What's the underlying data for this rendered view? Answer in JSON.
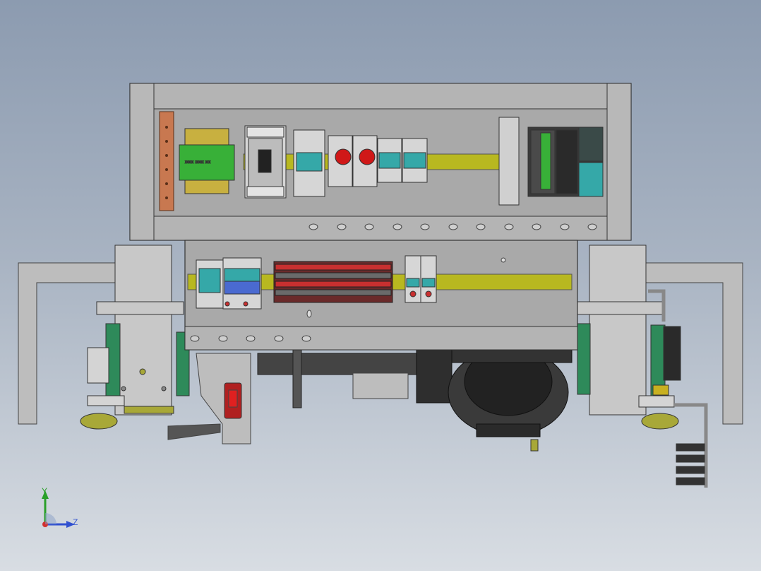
{
  "viewport": {
    "background_top": "#8c9bb0",
    "background_bottom": "#d8dde3"
  },
  "transformer": {
    "nameplate": "XXXXX XXXXX XXX"
  },
  "triad": {
    "y_label": "Y",
    "z_label": "Z",
    "y_color": "#2aa02a",
    "z_color": "#3050d0",
    "x_color": "#d03030"
  },
  "colors": {
    "panel": "#b4b4b4",
    "panel_dark": "#9c9c9c",
    "din_rail": "#b8b820",
    "copper": "#c87850",
    "transformer_core": "#38b038",
    "module_teal": "#35a8a8",
    "knob_red": "#d01818",
    "wheel_olive": "#a8a838",
    "motor_dark": "#333333",
    "flange_green": "#2e8a5a"
  }
}
